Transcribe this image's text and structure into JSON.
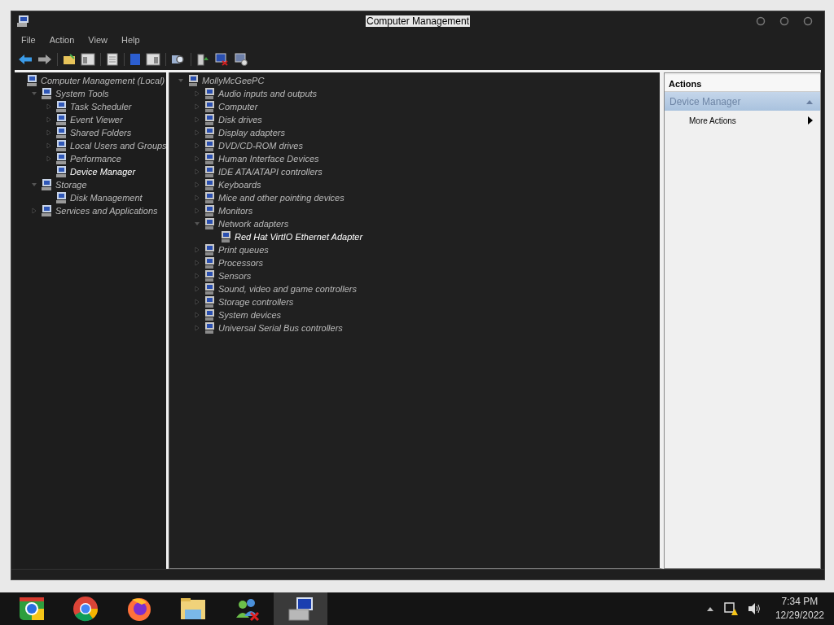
{
  "window": {
    "title": "Computer Management"
  },
  "menu": [
    "File",
    "Action",
    "View",
    "Help"
  ],
  "left_tree": [
    {
      "label": "Computer Management (Local)",
      "selected": false,
      "children": [
        {
          "label": "System Tools",
          "expanded": true,
          "selected": false,
          "children": [
            {
              "label": "Task Scheduler",
              "expanded": false,
              "selected": false
            },
            {
              "label": "Event Viewer",
              "expanded": false,
              "selected": false
            },
            {
              "label": "Shared Folders",
              "expanded": false,
              "selected": false
            },
            {
              "label": "Local Users and Groups",
              "expanded": false,
              "selected": false
            },
            {
              "label": "Performance",
              "expanded": false,
              "selected": false
            },
            {
              "label": "Device Manager",
              "selected": true
            }
          ]
        },
        {
          "label": "Storage",
          "expanded": true,
          "selected": false,
          "children": [
            {
              "label": "Disk Management",
              "selected": false
            }
          ]
        },
        {
          "label": "Services and Applications",
          "expanded": false,
          "selected": false
        }
      ]
    }
  ],
  "device_tree": [
    {
      "label": "MollyMcGeePC",
      "expanded": true,
      "selected": false,
      "children": [
        {
          "label": "Audio inputs and outputs",
          "expanded": false,
          "selected": false
        },
        {
          "label": "Computer",
          "expanded": false,
          "selected": false
        },
        {
          "label": "Disk drives",
          "expanded": false,
          "selected": false
        },
        {
          "label": "Display adapters",
          "expanded": false,
          "selected": false
        },
        {
          "label": "DVD/CD-ROM drives",
          "expanded": false,
          "selected": false
        },
        {
          "label": "Human Interface Devices",
          "expanded": false,
          "selected": false
        },
        {
          "label": "IDE ATA/ATAPI controllers",
          "expanded": false,
          "selected": false
        },
        {
          "label": "Keyboards",
          "expanded": false,
          "selected": false
        },
        {
          "label": "Mice and other pointing devices",
          "expanded": false,
          "selected": false
        },
        {
          "label": "Monitors",
          "expanded": false,
          "selected": false
        },
        {
          "label": "Network adapters",
          "expanded": true,
          "selected": false,
          "children": [
            {
              "label": "Red Hat VirtIO Ethernet Adapter",
              "selected": true
            }
          ]
        },
        {
          "label": "Print queues",
          "expanded": false,
          "selected": false
        },
        {
          "label": "Processors",
          "expanded": false,
          "selected": false
        },
        {
          "label": "Sensors",
          "expanded": false,
          "selected": false
        },
        {
          "label": "Sound, video and game controllers",
          "expanded": false,
          "selected": false
        },
        {
          "label": "Storage controllers",
          "expanded": false,
          "selected": false
        },
        {
          "label": "System devices",
          "expanded": false,
          "selected": false
        },
        {
          "label": "Universal Serial Bus controllers",
          "expanded": false,
          "selected": false
        }
      ]
    }
  ],
  "actions": {
    "header": "Actions",
    "section": {
      "label": "Device Manager",
      "expanded": true
    },
    "items": [
      "More Actions"
    ]
  },
  "taskbar": {
    "apps": [
      {
        "kind": "chrome-alt",
        "selected": false
      },
      {
        "kind": "chrome",
        "selected": false
      },
      {
        "kind": "firefox",
        "selected": false
      },
      {
        "kind": "folder",
        "selected": false
      },
      {
        "kind": "messenger",
        "selected": false
      },
      {
        "kind": "computer",
        "selected": true
      }
    ],
    "clock": {
      "time": "7:34 PM",
      "date": "12/29/2022"
    }
  }
}
